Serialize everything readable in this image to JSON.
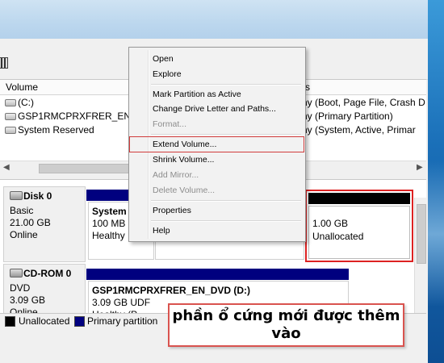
{
  "volume_list": {
    "columns": {
      "volume": "Volume",
      "status": "tus"
    },
    "rows": [
      {
        "name": "(C:)",
        "status": "lthy (Boot, Page File, Crash D"
      },
      {
        "name": "GSP1RMCPRXFRER_EN_DV",
        "status": "lthy (Primary Partition)"
      },
      {
        "name": "System Reserved",
        "status": "lthy (System, Active, Primar"
      }
    ]
  },
  "disks": [
    {
      "title": "Disk 0",
      "type": "Basic",
      "size": "21.00 GB",
      "state": "Online",
      "partitions": [
        {
          "name": "System",
          "size": "100 MB N",
          "status": "Healthy"
        }
      ],
      "unallocated": {
        "size": "1.00 GB",
        "label": "Unallocated"
      }
    },
    {
      "title": "CD-ROM 0",
      "type": "DVD",
      "size": "3.09 GB",
      "state": "Online",
      "partition": {
        "name": "GSP1RMCPRXFRER_EN_DVD  (D:)",
        "fs": "3.09 GB UDF",
        "status": "Healthy (P"
      }
    }
  ],
  "legend": {
    "unallocated": "Unallocated",
    "primary": "Primary partition"
  },
  "context_menu": {
    "items": [
      "Open",
      "Explore",
      "Mark Partition as Active",
      "Change Drive Letter and Paths...",
      "Format...",
      "Extend Volume...",
      "Shrink Volume...",
      "Add Mirror...",
      "Delete Volume...",
      "Properties",
      "Help"
    ],
    "highlighted": "Extend Volume..."
  },
  "annotation": {
    "line1": "phần ổ cứng mới được thêm",
    "line2": "vào"
  },
  "colors": {
    "primary_partition": "#00007f",
    "unallocated": "#000000",
    "highlight": "#d13c3c"
  },
  "icons": [
    "drive-icon",
    "disk-icon",
    "cdrom-icon"
  ]
}
